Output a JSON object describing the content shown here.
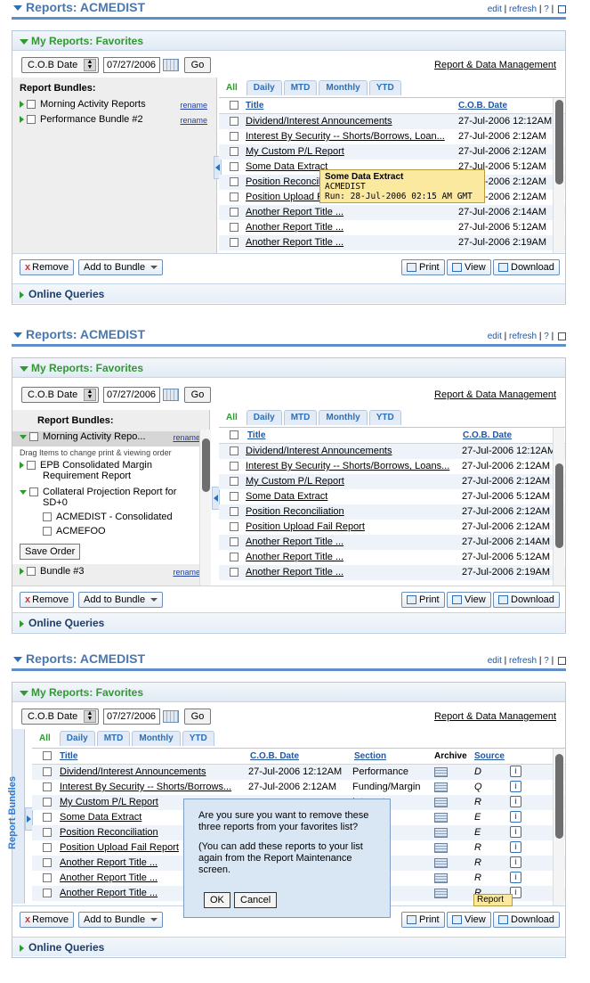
{
  "portlet_title": "Reports: ACMEDIST",
  "tools": {
    "edit": "edit",
    "refresh": "refresh",
    "help": "?"
  },
  "sub_title": "My Reports: Favorites",
  "filter": {
    "select_value": "C.O.B Date",
    "date": "07/27/2006",
    "go": "Go",
    "link": "Report & Data Management"
  },
  "bundles": {
    "heading": "Report Bundles:",
    "rename": "rename",
    "v1": [
      "Morning Activity Reports",
      "Performance Bundle #2"
    ],
    "v2": {
      "item1": "Morning Activity Repo...",
      "hint": "Drag  Items to change print  & viewing order",
      "item2_line1": "EPB Consolidated Margin",
      "item2_line2": "Requirement Report",
      "item3_line1": "Collateral Projection Report for",
      "item3_line2": "SD+0",
      "sub1": "ACMEDIST - Consolidated",
      "sub2": "ACMEFOO",
      "save_order": "Save Order",
      "item4": "Bundle #3"
    },
    "vertical_tab": "Report Bundles"
  },
  "tabs": [
    "All",
    "Daily",
    "MTD",
    "Monthly",
    "YTD"
  ],
  "columns": {
    "title": "Title",
    "cob": "C.O.B. Date",
    "section": "Section",
    "archive": "Archive",
    "source": "Source"
  },
  "rows_v1": [
    {
      "title": "Dividend/Interest Announcements",
      "date": "27-Jul-2006 12:12AM"
    },
    {
      "title": "Interest By Security -- Shorts/Borrows, Loan...",
      "date": "27-Jul-2006 2:12AM"
    },
    {
      "title": "My Custom P/L Report",
      "date": "27-Jul-2006 2:12AM"
    },
    {
      "title": "Some Data Extract",
      "date": "27-Jul-2006 5:12AM"
    },
    {
      "title": "Position Reconcili",
      "date": "27-Jul-2006 2:12AM"
    },
    {
      "title": "Position Upload F",
      "date": "27-Jul-2006 2:12AM"
    },
    {
      "title": "Another Report Title ...",
      "date": "27-Jul-2006 2:14AM"
    },
    {
      "title": "Another Report Title ...",
      "date": "27-Jul-2006 5:12AM"
    },
    {
      "title": "Another Report Title ...",
      "date": "27-Jul-2006 2:19AM"
    }
  ],
  "rows_v2": [
    {
      "title": "Dividend/Interest Announcements",
      "date": "27-Jul-2006 12:12AM"
    },
    {
      "title": "Interest By Security -- Shorts/Borrows, Loans...",
      "date": "27-Jul-2006 2:12AM"
    },
    {
      "title": "My Custom P/L Report",
      "date": "27-Jul-2006 2:12AM"
    },
    {
      "title": "Some Data Extract",
      "date": "27-Jul-2006 5:12AM"
    },
    {
      "title": "Position Reconciliation",
      "date": "27-Jul-2006 2:12AM"
    },
    {
      "title": "Position Upload Fail Report",
      "date": "27-Jul-2006 2:12AM"
    },
    {
      "title": "Another Report Title ...",
      "date": "27-Jul-2006 2:14AM"
    },
    {
      "title": "Another Report Title ...",
      "date": "27-Jul-2006 5:12AM"
    },
    {
      "title": "Another Report Title ...",
      "date": "27-Jul-2006 2:19AM"
    }
  ],
  "rows_v3": [
    {
      "title": "Dividend/Interest Announcements",
      "date": "27-Jul-2006 12:12AM",
      "section": "Performance",
      "source": "D"
    },
    {
      "title": "Interest By Security -- Shorts/Borrows...",
      "date": "27-Jul-2006 2:12AM",
      "section": "Funding/Margin",
      "source": "Q"
    },
    {
      "title": "My Custom P/L Report",
      "date": "",
      "section": "Interest",
      "source": "R"
    },
    {
      "title": "Some Data Extract",
      "date": "",
      "section": "Interest",
      "source": "E"
    },
    {
      "title": "Position Reconciliation",
      "date": "",
      "section": "ation",
      "source": "E"
    },
    {
      "title": "Position Upload Fail Report",
      "date": "",
      "section": "ment",
      "source": "R"
    },
    {
      "title": "Another Report Title ...",
      "date": "",
      "section": "ance",
      "source": "R"
    },
    {
      "title": "Another Report Title ...",
      "date": "",
      "section": "ons",
      "source": "R"
    },
    {
      "title": "Another Report Title ...",
      "date": "",
      "section": "ons",
      "source": "R"
    }
  ],
  "buttons": {
    "remove": "Remove",
    "add_to_bundle": "Add to Bundle",
    "print": "Print",
    "view": "View",
    "download": "Download"
  },
  "online_queries": "Online Queries",
  "tooltip": {
    "title": "Some Data Extract",
    "line1": "ACMEDIST",
    "line2": "Run: 28-Jul-2006 02:15 AM GMT"
  },
  "dialog": {
    "text1": "Are you sure you want to remove these three reports from your favorites list?",
    "text2": "(You can add these reports to your list again from the Report Maintenance screen.",
    "ok": "OK",
    "cancel": "Cancel"
  },
  "report_tooltip": "Report"
}
